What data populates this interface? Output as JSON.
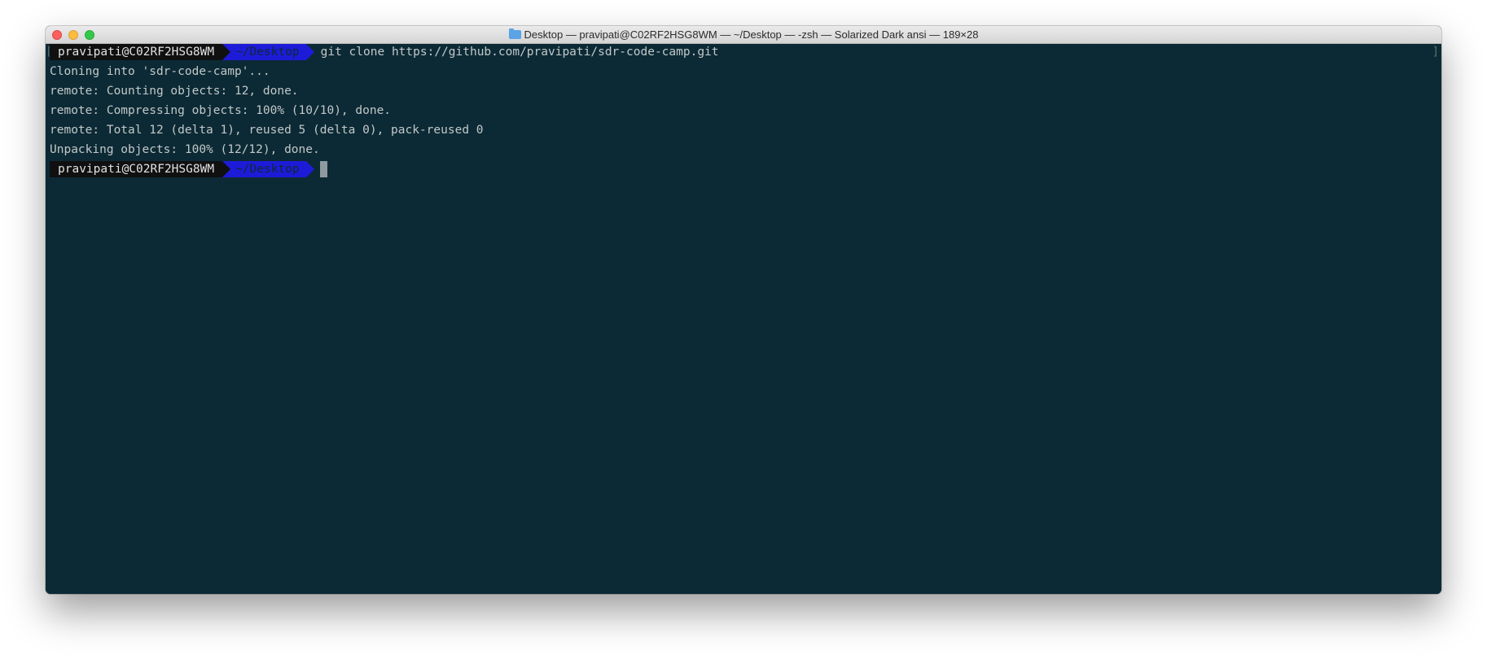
{
  "window": {
    "title": "Desktop — pravipati@C02RF2HSG8WM — ~/Desktop — -zsh — Solarized Dark ansi — 189×28",
    "title_icon": "folder-icon",
    "buttons": {
      "close": "close-button",
      "minimize": "minimize-button",
      "zoom": "zoom-button"
    }
  },
  "terminal": {
    "prompt_user": "pravipati@C02RF2HSG8WM",
    "prompt_dir": "~/Desktop",
    "command": "git clone https://github.com/pravipati/sdr-code-camp.git",
    "output": [
      "Cloning into 'sdr-code-camp'...",
      "remote: Counting objects: 12, done.",
      "remote: Compressing objects: 100% (10/10), done.",
      "remote: Total 12 (delta 1), reused 5 (delta 0), pack-reused 0",
      "Unpacking objects: 100% (12/12), done."
    ],
    "prompt2_user": "pravipati@C02RF2HSG8WM",
    "prompt2_dir": "~/Desktop",
    "bracket_left": "[",
    "bracket_right": "]"
  },
  "colors": {
    "background": "#0c2a35",
    "foreground": "#c2c8c8",
    "prompt_user_bg": "#101010",
    "prompt_dir_bg": "#1e1bd8"
  }
}
